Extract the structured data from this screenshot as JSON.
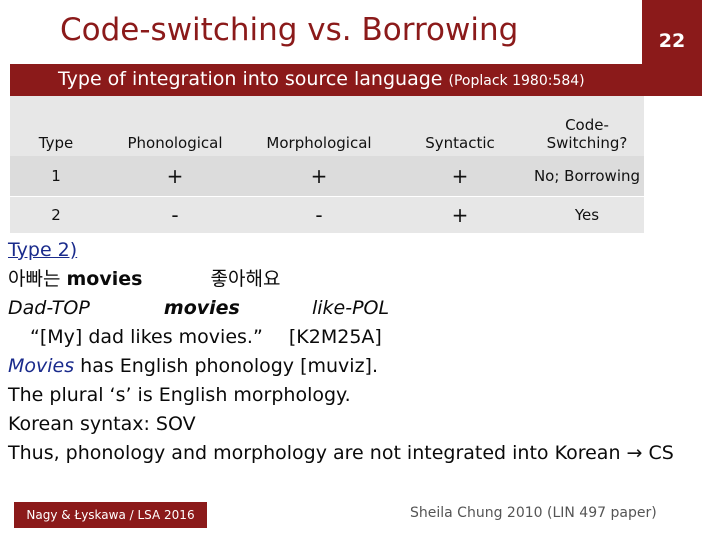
{
  "slide": {
    "title": "Code-switching vs. Borrowing",
    "page_number": "22"
  },
  "table": {
    "caption_main": "Type of integration into source language",
    "caption_cite": "(Poplack 1980:584)",
    "headers": [
      "Type",
      "Phonological",
      "Morphological",
      "Syntactic",
      "Code-Switching?"
    ],
    "rows": [
      [
        "1",
        "+",
        "+",
        "+",
        "No; Borrowing"
      ],
      [
        "2",
        "-",
        "-",
        "+",
        "Yes"
      ]
    ]
  },
  "body": {
    "type2_label": "Type 2)",
    "korean_word1": "아빠는",
    "korean_movies": "movies",
    "korean_word2": "좋아해요",
    "gloss_1": "Dad-TOP",
    "gloss_2": "movies",
    "gloss_3": "like-POL",
    "translation": "“[My] dad likes movies.”",
    "translation_code": "[K2M25A]",
    "movies_word": "Movies",
    "phonology_rest": " has English phonology [muviz].",
    "plural_line": "The plural ‘s’ is English morphology.",
    "syntax_line": "Korean syntax: SOV",
    "conclusion_text": "Thus, phonology and morphology are not integrated into Korean",
    "conclusion_arrow": "→",
    "conclusion_end": "CS"
  },
  "footer": {
    "left": "Nagy & Łyskawa / LSA 2016",
    "right": "Sheila Chung 2010 (LIN 497 paper)"
  },
  "colors": {
    "accent": "#8b1a1a",
    "table_bg": "#e7e7e7",
    "example_blue": "#1a2b8c"
  }
}
